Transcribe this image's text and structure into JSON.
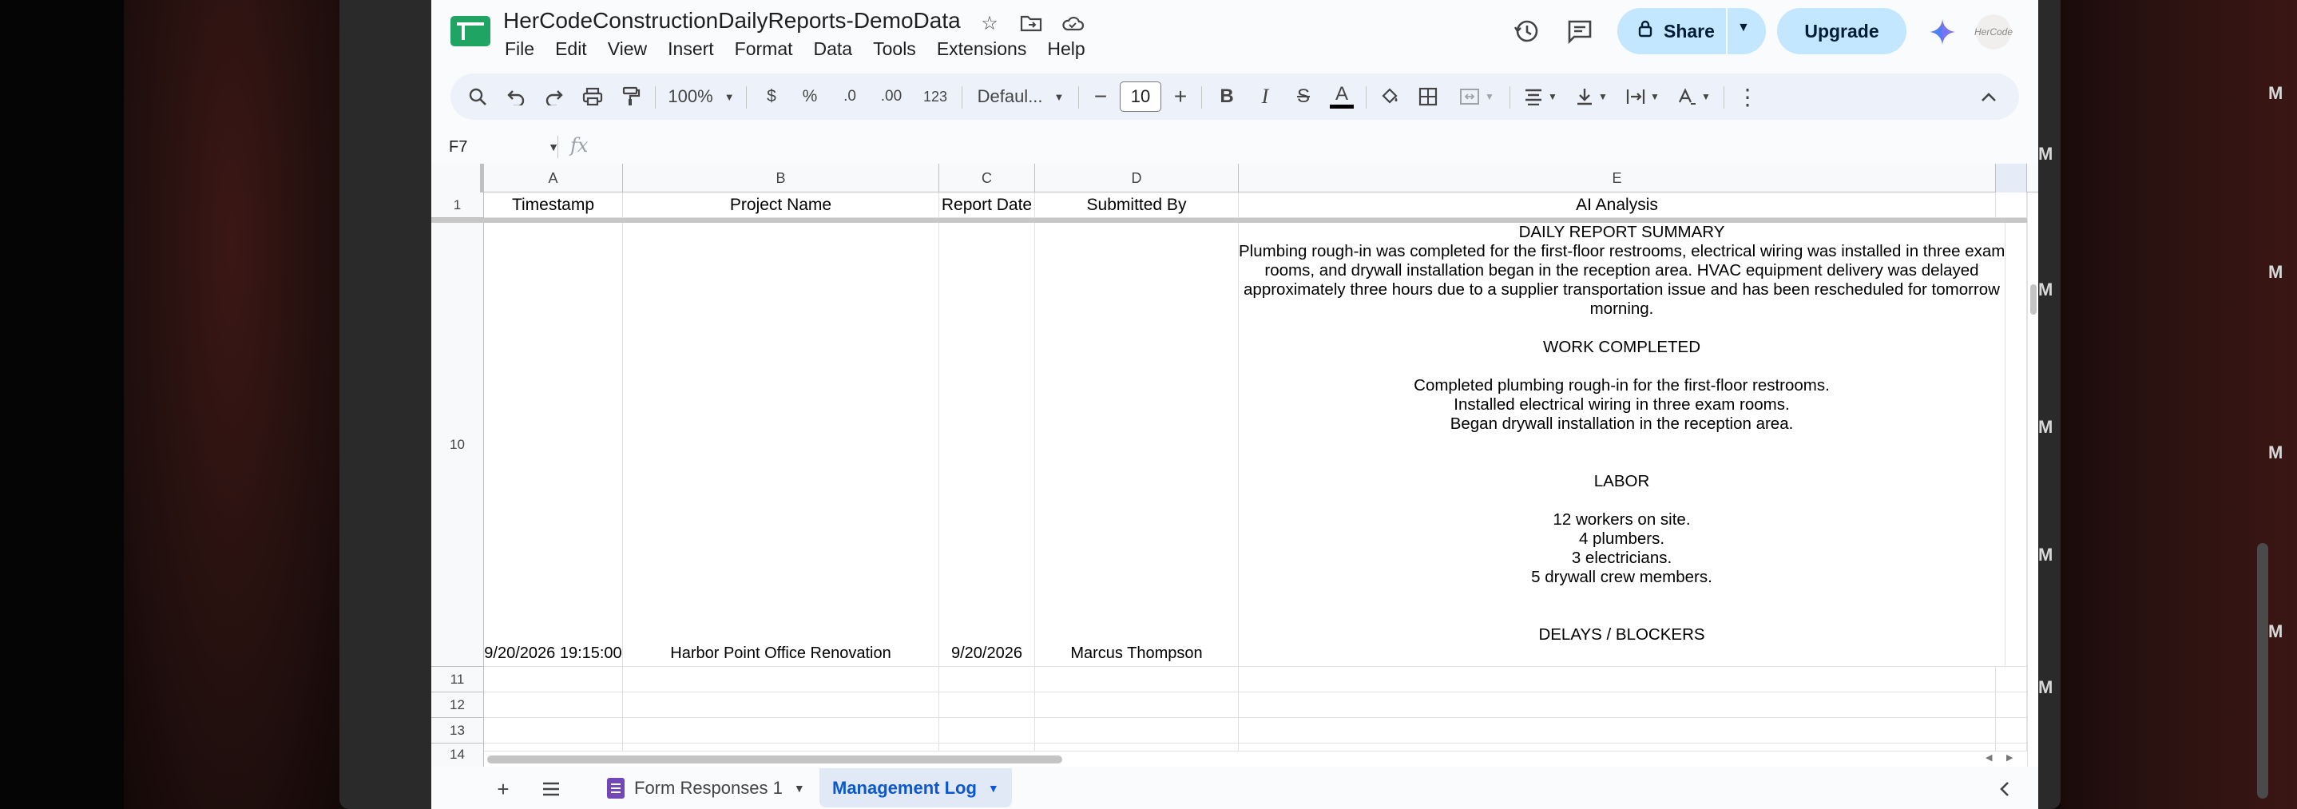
{
  "document": {
    "title": "HerCodeConstructionDailyReports-DemoData",
    "avatar_text": "HerCode"
  },
  "menu": [
    "File",
    "Edit",
    "View",
    "Insert",
    "Format",
    "Data",
    "Tools",
    "Extensions",
    "Help"
  ],
  "header_buttons": {
    "share": "Share",
    "upgrade": "Upgrade"
  },
  "toolbar": {
    "zoom": "100%",
    "currency": "$",
    "percent": "%",
    "decrease_decimal": ".0",
    "increase_decimal": ".00",
    "number_format": "123",
    "font": "Defaul...",
    "font_size": "10",
    "bold": "B",
    "italic": "I",
    "strikethrough": "S",
    "text_color": "A"
  },
  "formula_bar": {
    "cell_ref": "F7",
    "fx": "fx",
    "content": ""
  },
  "grid": {
    "columns": [
      "A",
      "B",
      "C",
      "D",
      "E"
    ],
    "header_row_number": "1",
    "headers": [
      "Timestamp",
      "Project Name",
      "Report Date",
      "Submitted By",
      "AI Analysis"
    ],
    "rows": [
      {
        "row_number": "10",
        "timestamp": "9/20/2026 19:15:00",
        "project_name": "Harbor Point Office Renovation",
        "report_date": "9/20/2026",
        "submitted_by": "Marcus Thompson",
        "ai_analysis_lines": [
          "DAILY REPORT SUMMARY",
          "Plumbing rough-in was completed for the first-floor restrooms, electrical wiring was installed in three exam",
          "rooms, and drywall installation began in the reception area. HVAC equipment delivery was delayed",
          "approximately three hours due to a supplier transportation issue and has been rescheduled for tomorrow",
          "morning.",
          "",
          "WORK COMPLETED",
          "",
          "Completed plumbing rough-in for the first-floor restrooms.",
          "Installed electrical wiring in three exam rooms.",
          "Began drywall installation in the reception area.",
          "",
          "",
          "LABOR",
          "",
          "12 workers on site.",
          "4 plumbers.",
          "3 electricians.",
          "5 drywall crew members.",
          "",
          "",
          "DELAYS / BLOCKERS"
        ]
      }
    ],
    "empty_row_numbers": [
      "11",
      "12",
      "13",
      "14"
    ]
  },
  "sheet_tabs": [
    {
      "label": "Form Responses 1",
      "active": false
    },
    {
      "label": "Management Log",
      "active": true
    }
  ],
  "colors": {
    "accent": "#0b57d0",
    "share_bg": "#c2e7ff",
    "sheets_green": "#1fa463",
    "forms_purple": "#7248b9"
  }
}
